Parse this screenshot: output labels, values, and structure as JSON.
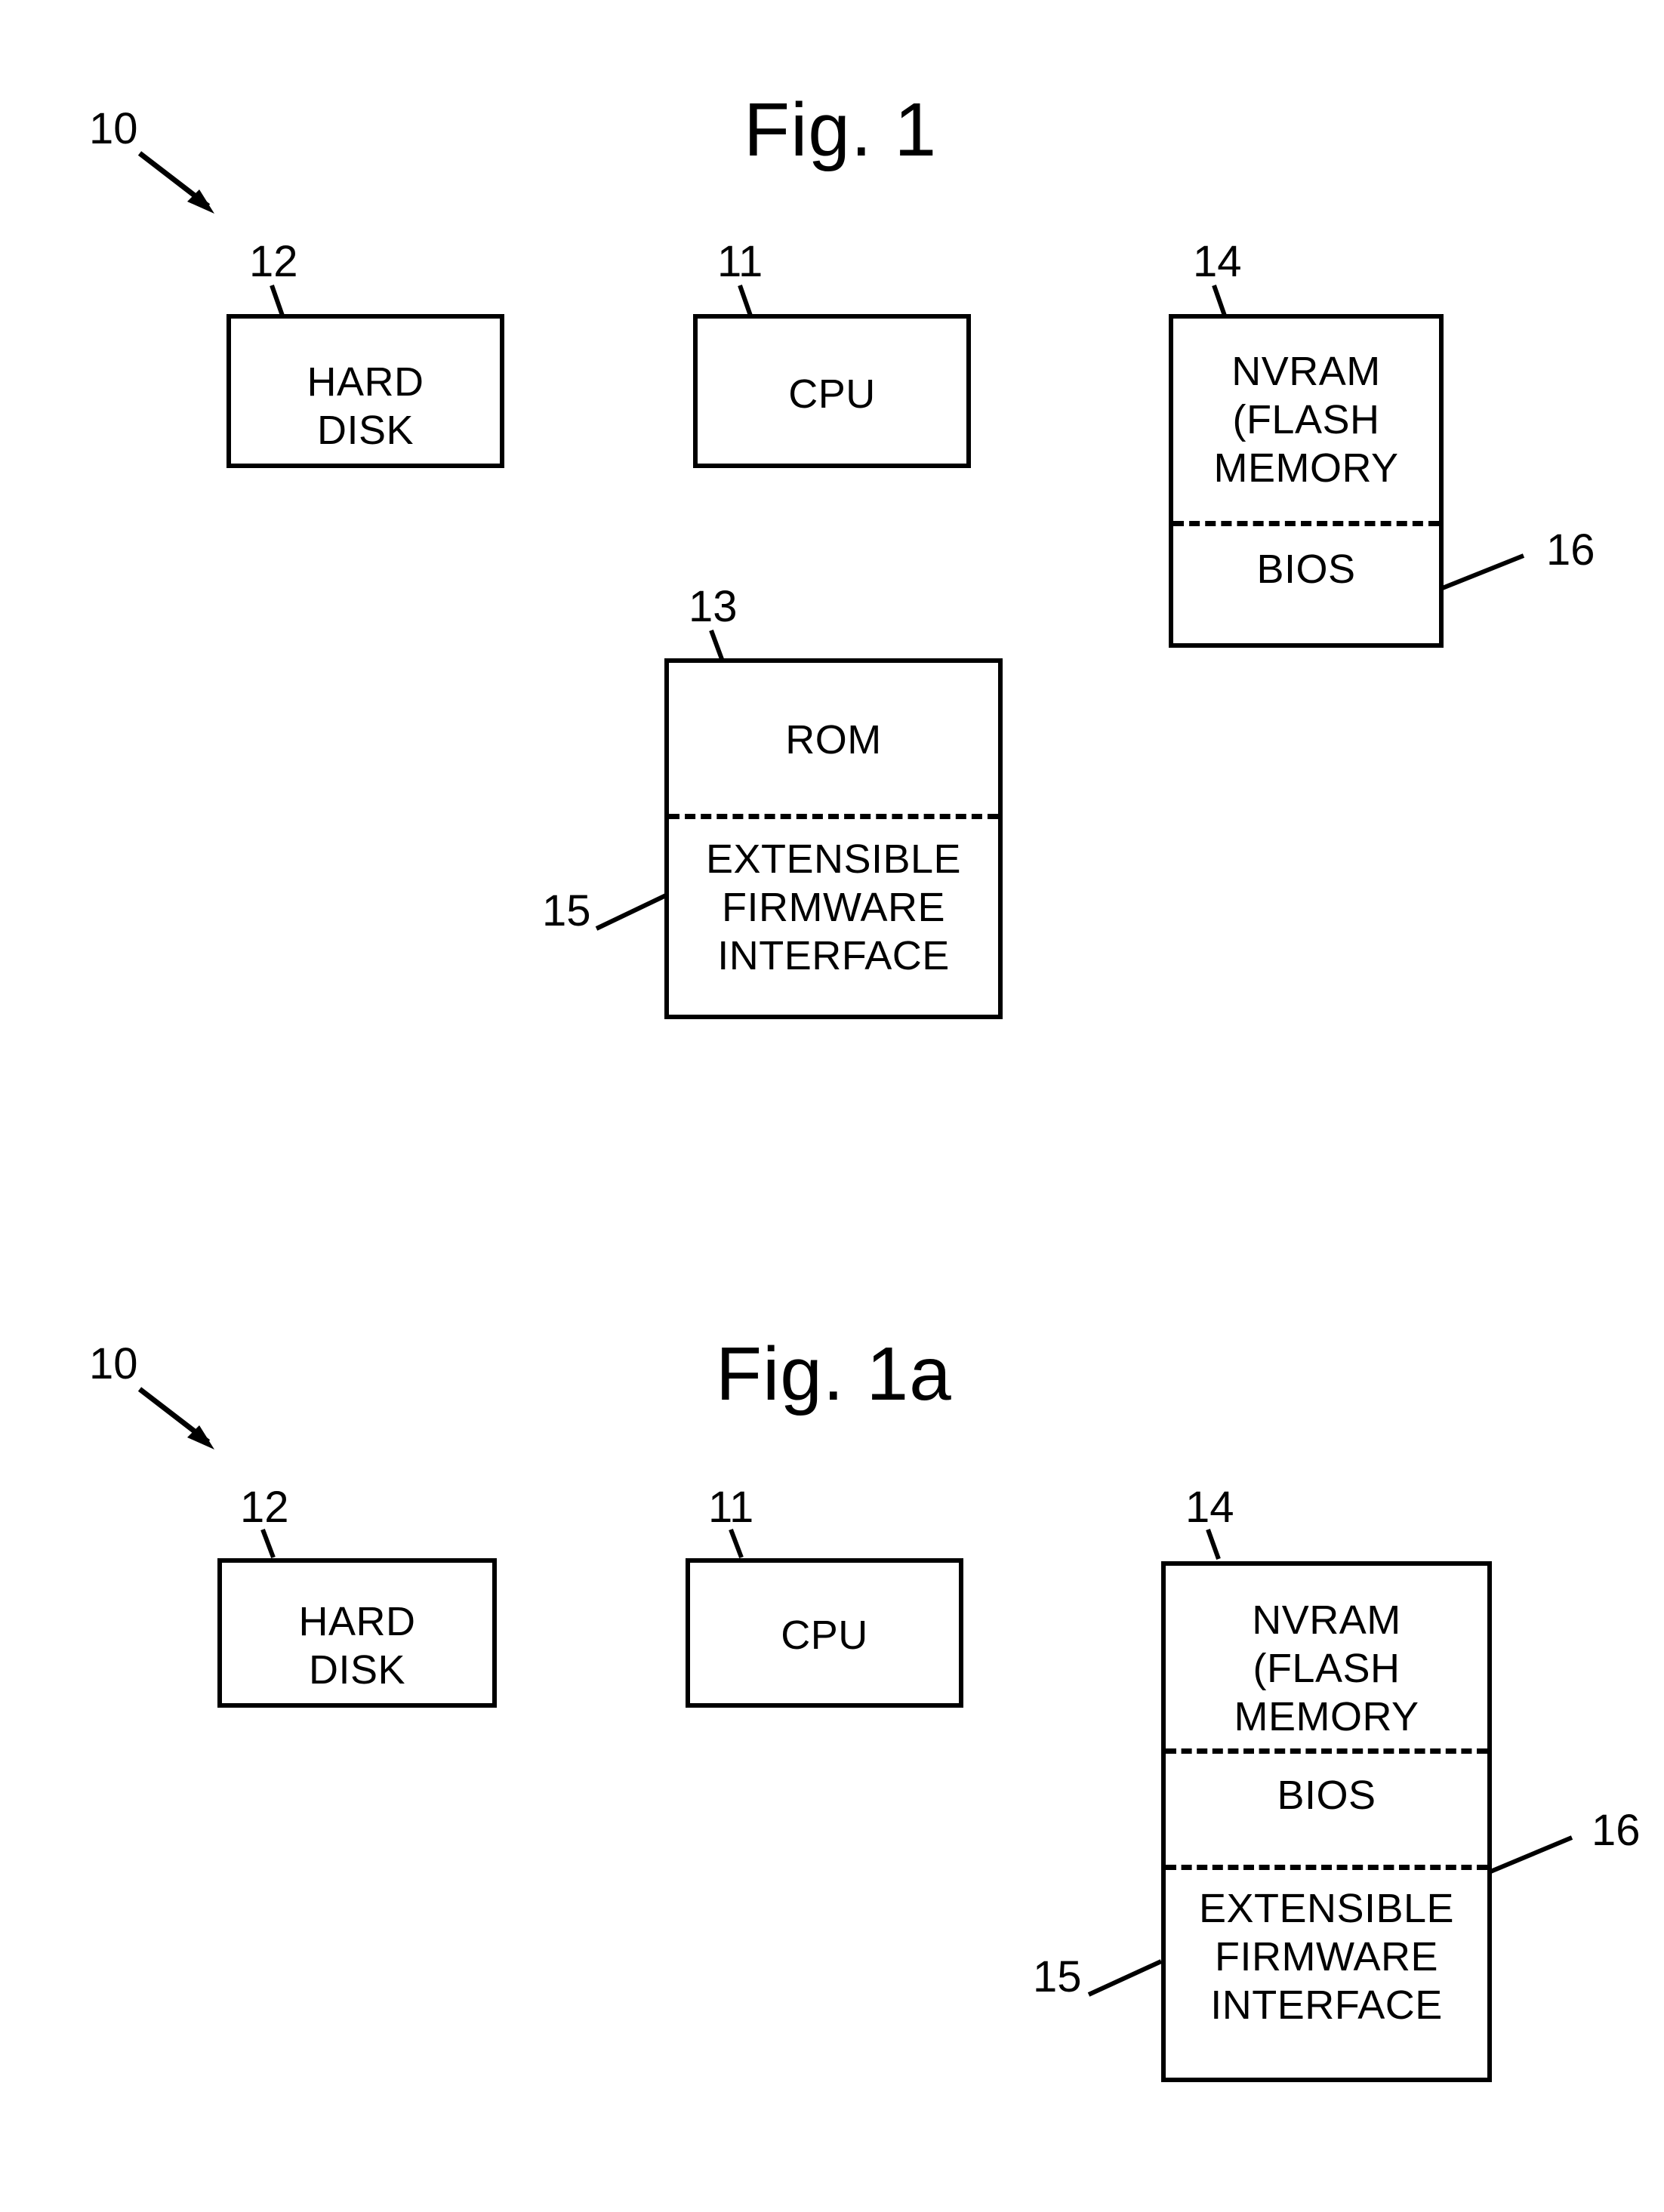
{
  "figures": [
    {
      "id": "fig1",
      "title": "Fig. 1",
      "system_ref": "10",
      "boxes": [
        {
          "id": "hard-disk",
          "label": "HARD\nDISK",
          "ref": "12"
        },
        {
          "id": "cpu",
          "label": "CPU",
          "ref": "11"
        },
        {
          "id": "nvram",
          "label": "NVRAM\n(FLASH\nMEMORY",
          "ref": "14",
          "sections": [
            {
              "label": "BIOS",
              "ref": "16"
            }
          ]
        },
        {
          "id": "rom",
          "label": "ROM",
          "ref": "13",
          "sections": [
            {
              "label": "EXTENSIBLE\nFIRMWARE\nINTERFACE",
              "ref": "15"
            }
          ]
        }
      ],
      "connections": [
        {
          "from": "hard-disk",
          "to": "cpu",
          "kind": "double-arrow-horizontal"
        },
        {
          "from": "cpu",
          "to": "nvram",
          "kind": "double-arrow-horizontal"
        },
        {
          "from": "cpu",
          "to": "rom",
          "kind": "double-arrow-vertical"
        }
      ]
    },
    {
      "id": "fig1a",
      "title": "Fig. 1a",
      "system_ref": "10",
      "boxes": [
        {
          "id": "hard-disk",
          "label": "HARD\nDISK",
          "ref": "12"
        },
        {
          "id": "cpu",
          "label": "CPU",
          "ref": "11"
        },
        {
          "id": "nvram",
          "label": "NVRAM\n(FLASH\nMEMORY",
          "ref": "14",
          "sections": [
            {
              "label": "BIOS",
              "ref": "16"
            },
            {
              "label": "EXTENSIBLE\nFIRMWARE\nINTERFACE",
              "ref": "15"
            }
          ]
        }
      ],
      "connections": [
        {
          "from": "hard-disk",
          "to": "cpu",
          "kind": "double-arrow-horizontal"
        },
        {
          "from": "cpu",
          "to": "nvram",
          "kind": "double-arrow-horizontal"
        }
      ]
    }
  ],
  "colors": {
    "ink": "#000000",
    "paper": "#ffffff"
  }
}
